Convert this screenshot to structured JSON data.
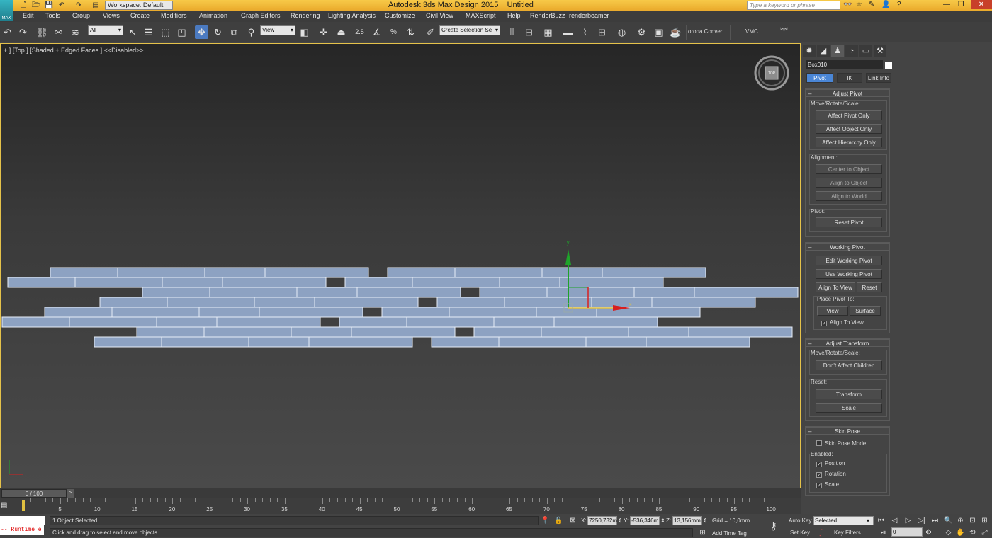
{
  "app": {
    "title": "Autodesk 3ds Max Design 2015",
    "document": "Untitled",
    "logo_text": "MAX",
    "workspace": "Workspace: Default",
    "search_placeholder": "Type a keyword or phrase"
  },
  "menu": [
    "Edit",
    "Tools",
    "Group",
    "Views",
    "Create",
    "Modifiers",
    "Animation",
    "Graph Editors",
    "Rendering",
    "Lighting Analysis",
    "Customize",
    "Civil View",
    "MAXScript",
    "Help",
    "RenderBuzz",
    "renderbeamer"
  ],
  "toolbar": {
    "selection_filter": "All",
    "ref_coord": "View",
    "snap_angle": "2.5",
    "named_selection": "Create Selection Se",
    "corona_label": "orona Convert",
    "vmc_label": "VMC"
  },
  "viewport": {
    "label": "+ ] [Top ] [Shaded + Edged Faces ]  <<Disabled>>",
    "viewcube_label": "TOP",
    "gizmo_y": "y",
    "gizmo_x": "x",
    "plank_color": "#8da2c2",
    "plank_edge": "#e8eef8",
    "x_axis_color": "#d81f1f",
    "y_axis_color": "#1fa32a"
  },
  "command_panel": {
    "object_name": "Box010",
    "object_color": "#ffffff",
    "hierarchy_tabs": [
      "Pivot",
      "IK",
      "Link Info"
    ],
    "selected_tab": "Pivot",
    "adjust_pivot": {
      "title": "Adjust Pivot",
      "move_label": "Move/Rotate/Scale:",
      "buttons": [
        "Affect Pivot Only",
        "Affect Object Only",
        "Affect Hierarchy Only"
      ],
      "alignment_label": "Alignment:",
      "align_buttons": [
        "Center to Object",
        "Align to Object",
        "Align to World"
      ],
      "pivot_label": "Pivot:",
      "reset_pivot": "Reset Pivot"
    },
    "working_pivot": {
      "title": "Working Pivot",
      "edit": "Edit Working Pivot",
      "use": "Use Working Pivot",
      "align_to_view": "Align To View",
      "reset": "Reset",
      "place_label": "Place Pivot To:",
      "view": "View",
      "surface": "Surface",
      "align_check": "Align To View"
    },
    "adjust_transform": {
      "title": "Adjust Transform",
      "move_label": "Move/Rotate/Scale:",
      "dont_affect": "Don't Affect Children",
      "reset_label": "Reset:",
      "transform": "Transform",
      "scale": "Scale"
    },
    "skin_pose": {
      "title": "Skin Pose",
      "mode": "Skin Pose Mode",
      "enabled_label": "Enabled:",
      "position": "Position",
      "rotation": "Rotation",
      "scale": "Scale"
    }
  },
  "timeline": {
    "frame": "0 / 100",
    "ticks": [
      "0",
      "5",
      "10",
      "15",
      "20",
      "25",
      "30",
      "35",
      "40",
      "45",
      "50",
      "55",
      "60",
      "65",
      "70",
      "75",
      "80",
      "85",
      "90",
      "95",
      "100"
    ]
  },
  "status": {
    "maxscript": "-- Runtime e",
    "selected": "1 Object Selected",
    "prompt": "Click and drag to select and move objects",
    "x_label": "X:",
    "x_value": "7250,732m",
    "y_label": "Y:",
    "y_value": "-536,346m",
    "z_label": "Z:",
    "z_value": "13,156mm",
    "grid": "Grid = 10,0mm",
    "add_time_tag": "Add Time Tag",
    "auto_key": "Auto Key",
    "set_key": "Set Key",
    "key_mode": "Selected",
    "key_filters": "Key Filters...",
    "current_frame": "0"
  }
}
